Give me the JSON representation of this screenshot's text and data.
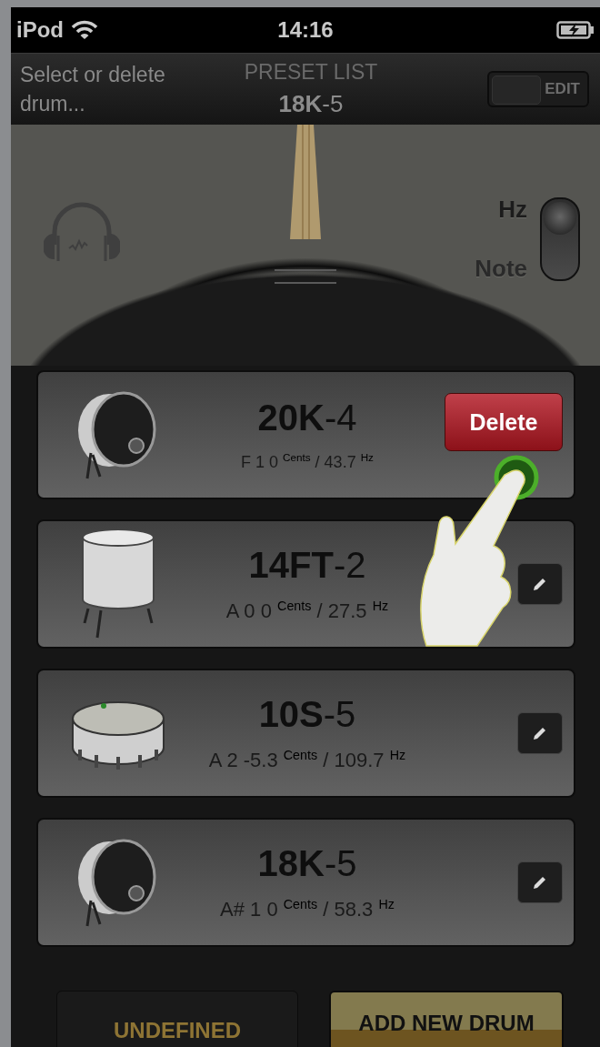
{
  "status_bar": {
    "carrier": "iPod",
    "time": "14:16"
  },
  "header": {
    "instruction": "Select or delete drum...",
    "title": "PRESET LIST",
    "current_preset": "**18K**-5",
    "edit_switch": {
      "label": "EDIT",
      "on": false
    }
  },
  "unit_toggle": {
    "options": [
      {
        "label": "Hz",
        "selected": true
      },
      {
        "label": "Note",
        "selected": false
      }
    ]
  },
  "presets": [
    {
      "kind": "bass-drum",
      "name": "**20K**-4",
      "reading": "F 1 0 $^{Cents}$ / 43.7 $^{Hz}$",
      "deleting": true,
      "delete_label": "Delete"
    },
    {
      "kind": "floor-tom",
      "name": "**14FT**-2",
      "reading": "A 0 0 $^{Cents}$ / 27.5 $^{Hz}$",
      "deleting": false
    },
    {
      "kind": "snare-drum",
      "name": "**10S**-5",
      "reading": "A 2 -5.3 $^{Cents}$ / 109.7 $^{Hz}$",
      "deleting": false
    },
    {
      "kind": "bass-drum",
      "name": "**18K**-5",
      "reading": "A# 1 0 $^{Cents}$ / 58.3 $^{Hz}$",
      "deleting": false
    }
  ],
  "buttons": {
    "left": "UNDEFINED",
    "right": "ADD NEW DRUM"
  }
}
